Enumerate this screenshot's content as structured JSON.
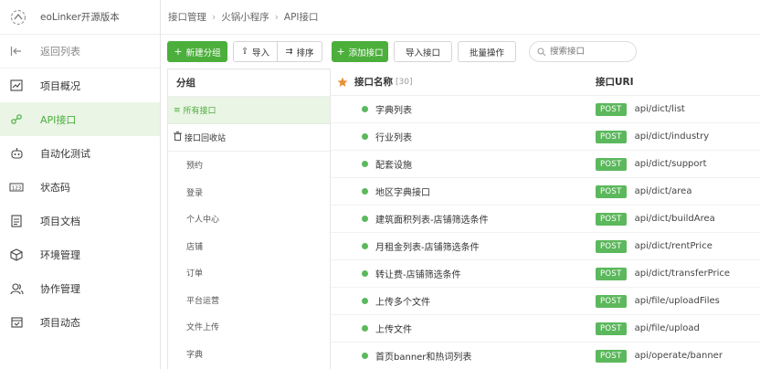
{
  "brand": {
    "name": "eoLinker开源版本",
    "logo_icon": "eolinker-logo-icon"
  },
  "breadcrumb": [
    "接口管理",
    "火锅小程序",
    "API接口"
  ],
  "sidebar": {
    "back_label": "返回列表",
    "items": [
      {
        "label": "项目概况",
        "icon": "chart-icon",
        "active": false
      },
      {
        "label": "API接口",
        "icon": "api-link-icon",
        "active": true
      },
      {
        "label": "自动化测试",
        "icon": "robot-icon",
        "active": false
      },
      {
        "label": "状态码",
        "icon": "status-code-icon",
        "active": false
      },
      {
        "label": "项目文档",
        "icon": "document-icon",
        "active": false
      },
      {
        "label": "环境管理",
        "icon": "cube-icon",
        "active": false
      },
      {
        "label": "协作管理",
        "icon": "users-icon",
        "active": false
      },
      {
        "label": "项目动态",
        "icon": "calendar-icon",
        "active": false
      }
    ]
  },
  "toolbar": {
    "new_group": "新建分组",
    "import": "导入",
    "sort": "排序",
    "add_api": "添加接口",
    "import_api": "导入接口",
    "batch": "批量操作",
    "search_placeholder": "搜索接口"
  },
  "groups": {
    "header": "分组",
    "all": "所有接口",
    "recycle": "接口回收站",
    "items": [
      "预约",
      "登录",
      "个人中心",
      "店铺",
      "订单",
      "平台运营",
      "文件上传",
      "字典"
    ]
  },
  "api_table": {
    "col_name": "接口名称",
    "count": "[30]",
    "col_uri": "接口URI",
    "rows": [
      {
        "name": "字典列表",
        "method": "POST",
        "uri": "api/dict/list"
      },
      {
        "name": "行业列表",
        "method": "POST",
        "uri": "api/dict/industry"
      },
      {
        "name": "配套设施",
        "method": "POST",
        "uri": "api/dict/support"
      },
      {
        "name": "地区字典接口",
        "method": "POST",
        "uri": "api/dict/area"
      },
      {
        "name": "建筑面积列表-店铺筛选条件",
        "method": "POST",
        "uri": "api/dict/buildArea"
      },
      {
        "name": "月租金列表-店铺筛选条件",
        "method": "POST",
        "uri": "api/dict/rentPrice"
      },
      {
        "name": "转让费-店铺筛选条件",
        "method": "POST",
        "uri": "api/dict/transferPrice"
      },
      {
        "name": "上传多个文件",
        "method": "POST",
        "uri": "api/file/uploadFiles"
      },
      {
        "name": "上传文件",
        "method": "POST",
        "uri": "api/file/upload"
      },
      {
        "name": "首页banner和热词列表",
        "method": "POST",
        "uri": "api/operate/banner"
      }
    ]
  },
  "colors": {
    "accent": "#4caf3c",
    "badge": "#5cb85c",
    "active_bg": "#eaf5e6",
    "star": "#e8913a"
  }
}
